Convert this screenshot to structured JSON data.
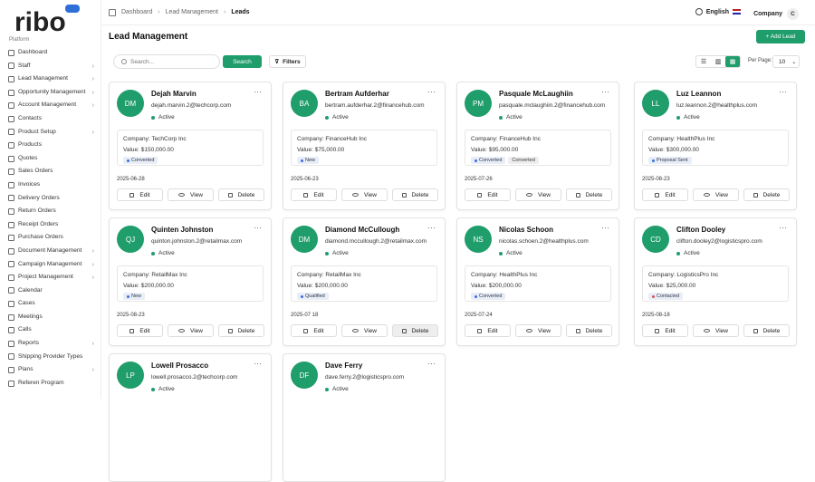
{
  "brand": {
    "logo_text": "ribo",
    "platform": "Platform"
  },
  "nav": [
    {
      "label": "Dashboard",
      "chev": false
    },
    {
      "label": "Staff",
      "chev": true
    },
    {
      "label": "Lead Management",
      "chev": true
    },
    {
      "label": "Opportunity Management",
      "chev": true
    },
    {
      "label": "Account Management",
      "chev": true
    },
    {
      "label": "Contacts",
      "chev": false
    },
    {
      "label": "Product Setup",
      "chev": true
    },
    {
      "label": "Products",
      "chev": false
    },
    {
      "label": "Quotes",
      "chev": false
    },
    {
      "label": "Sales Orders",
      "chev": false
    },
    {
      "label": "Invoices",
      "chev": false
    },
    {
      "label": "Delivery Orders",
      "chev": false
    },
    {
      "label": "Return Orders",
      "chev": false
    },
    {
      "label": "Receipt Orders",
      "chev": false
    },
    {
      "label": "Purchase Orders",
      "chev": false
    },
    {
      "label": "Document Management",
      "chev": true
    },
    {
      "label": "Campaign Management",
      "chev": true
    },
    {
      "label": "Project Management",
      "chev": true
    },
    {
      "label": "Calendar",
      "chev": false
    },
    {
      "label": "Cases",
      "chev": false
    },
    {
      "label": "Meetings",
      "chev": false
    },
    {
      "label": "Calls",
      "chev": false
    },
    {
      "label": "Reports",
      "chev": true
    },
    {
      "label": "Shipping Provider Types",
      "chev": false
    },
    {
      "label": "Plans",
      "chev": true
    },
    {
      "label": "Referen Program",
      "chev": false
    }
  ],
  "breadcrumb": [
    "Dashboard",
    "Lead Management",
    "Leads"
  ],
  "header": {
    "language": "English",
    "company": "Company",
    "company_initial": "C"
  },
  "page": {
    "title": "Lead Management",
    "add_label": "+ Add Lead"
  },
  "toolbar": {
    "search_placeholder": "Search...",
    "search_label": "Search",
    "filters_label": "Filters",
    "per_page_label": "Per Page:",
    "per_page_value": "10"
  },
  "actions": {
    "edit": "Edit",
    "view": "View",
    "delete": "Delete"
  },
  "leads": [
    {
      "initials": "DM",
      "name": "Dejah Marvin",
      "email": "dejah.marvin.2@techcorp.com",
      "status": "Active",
      "company": "Company: TechCorp Inc",
      "value": "Value: $150,000.00",
      "tags": [
        {
          "t": "Converted",
          "c": "blue"
        }
      ],
      "date": "2025-06-28"
    },
    {
      "initials": "BA",
      "name": "Bertram Aufderhar",
      "email": "bertram.aufderhar.2@financehub.com",
      "status": "Active",
      "company": "Company: FinanceHub Inc",
      "value": "Value: $75,000.00",
      "tags": [
        {
          "t": "New",
          "c": "blue"
        }
      ],
      "date": "2025-06-23"
    },
    {
      "initials": "PM",
      "name": "Pasquale McLaughiin",
      "email": "pasquale.mclaughiin.2@financehub.com",
      "status": "Active",
      "company": "Company: FinanceHub Inc",
      "value": "Value: $95,000.00",
      "tags": [
        {
          "t": "Converted",
          "c": "blue"
        },
        {
          "t": "Converted",
          "c": "grey"
        }
      ],
      "date": "2025-07-26"
    },
    {
      "initials": "LL",
      "name": "Luz Leannon",
      "email": "luz.leannon.2@healthplus.com",
      "status": "Active",
      "company": "Company: HealthPlus Inc",
      "value": "Value: $300,000.00",
      "tags": [
        {
          "t": "Proposal Sent",
          "c": "blue"
        }
      ],
      "date": "2025-08-23"
    },
    {
      "initials": "QJ",
      "name": "Quinten Johnston",
      "email": "quinton.johnston.2@retailmax.com",
      "status": "Active",
      "company": "Company: RetailMax Inc",
      "value": "Value: $200,000.00",
      "tags": [
        {
          "t": "New",
          "c": "blue"
        }
      ],
      "date": "2025-08-23"
    },
    {
      "initials": "DM",
      "name": "Diamond McCullough",
      "email": "diamond.mccullough.2@retailmax.com",
      "status": "Active",
      "company": "Company: RetailMax Inc",
      "value": "Value: $200,000.00",
      "tags": [
        {
          "t": "Qualified",
          "c": "blue"
        }
      ],
      "date": "2025-07 18"
    },
    {
      "initials": "NS",
      "name": "Nicolas Schoon",
      "email": "nicolas.schoen.2@healthplus.com",
      "status": "Active",
      "company": "Company: HealthPlus Inc",
      "value": "Value: $200,000.00",
      "tags": [
        {
          "t": "Converted",
          "c": "blue"
        }
      ],
      "date": "2025-07-24"
    },
    {
      "initials": "CD",
      "name": "Clifton Dooley",
      "email": "clifton.dooley2@logisticspro.com",
      "status": "Active",
      "company": "Company: LogisticsPro Inc",
      "value": "Value: $25,000.00",
      "tags": [
        {
          "t": "Contacted",
          "c": "red"
        }
      ],
      "date": "2025-08-18"
    },
    {
      "initials": "LP",
      "name": "Lowell Prosacco",
      "email": "lowell.prosacco.2@techcorp.com",
      "status": "Active",
      "company": "",
      "value": "",
      "tags": [],
      "date": ""
    },
    {
      "initials": "DF",
      "name": "Dave Ferry",
      "email": "dave.ferry.2@logisticspro.com",
      "status": "Active",
      "company": "",
      "value": "",
      "tags": [],
      "date": ""
    }
  ],
  "colors": {
    "accent": "#1f9d6b",
    "tag_blue_dot": "#3a6fd8",
    "tag_red_dot": "#d9534f"
  }
}
